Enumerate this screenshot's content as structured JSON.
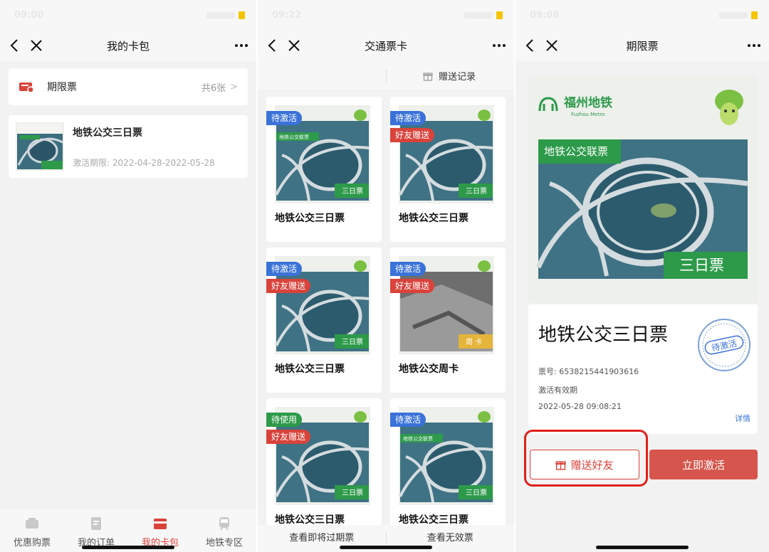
{
  "status": {
    "time_1": "09:00",
    "time_2": "09:22",
    "time_3": "09:08"
  },
  "colors": {
    "accent_red": "#d9433b",
    "badge_blue": "#3a72d8",
    "metro_green": "#2d9a4a",
    "week_gold": "#e5b43a"
  },
  "screen1": {
    "title": "我的卡包",
    "pass_row": {
      "icon": "ticket-icon",
      "label": "期限票",
      "count": "共6张",
      "chevron": ">"
    },
    "ticket": {
      "name": "地铁公交三日票",
      "validity": "激活期限: 2022-04-28-2022-05-28"
    },
    "tabs": [
      {
        "label": "优惠购票",
        "icon": "ticket-purchase-icon"
      },
      {
        "label": "我的订单",
        "icon": "order-icon"
      },
      {
        "label": "我的卡包",
        "icon": "wallet-icon"
      },
      {
        "label": "地铁专区",
        "icon": "metro-train-icon"
      }
    ]
  },
  "screen2": {
    "title": "交通票卡",
    "gift_record": "赠送记录",
    "cards": [
      {
        "name": "地铁公交三日票",
        "badges": [
          "待激活"
        ],
        "type_tag": "三日票",
        "combo_tag": "地铁公交联票"
      },
      {
        "name": "地铁公交三日票",
        "badges": [
          "待激活",
          "好友赠送"
        ],
        "type_tag": "三日票",
        "combo_tag": ""
      },
      {
        "name": "地铁公交三日票",
        "badges": [
          "待激活",
          "好友赠送"
        ],
        "type_tag": "三日票",
        "combo_tag": ""
      },
      {
        "name": "地铁公交周卡",
        "badges": [
          "待激活",
          "好友赠送"
        ],
        "type_tag": "周 卡",
        "combo_tag": ""
      },
      {
        "name": "地铁公交三日票",
        "badges": [
          "待使用",
          "好友赠送"
        ],
        "type_tag": "三日票",
        "combo_tag": ""
      },
      {
        "name": "地铁公交三日票",
        "badges": [
          "待激活"
        ],
        "type_tag": "三日票",
        "combo_tag": "地铁公交联票"
      }
    ],
    "footer": {
      "expiring": "查看即将过期票",
      "invalid": "查看无效票"
    }
  },
  "screen3": {
    "title": "期限票",
    "logo_text": "福州地铁",
    "logo_sub": "Fuzhou Metro",
    "combo_tag": "地铁公交联票",
    "type_tag": "三日票",
    "ticket_name": "地铁公交三日票",
    "stamp": "待激活",
    "ticket_no": "票号: 6538215441903616",
    "validity_label": "激活有效期",
    "validity_value": "2022-05-28 09:08:21",
    "details_link": "详情",
    "gift_button": "赠送好友",
    "activate_button": "立即激活"
  }
}
